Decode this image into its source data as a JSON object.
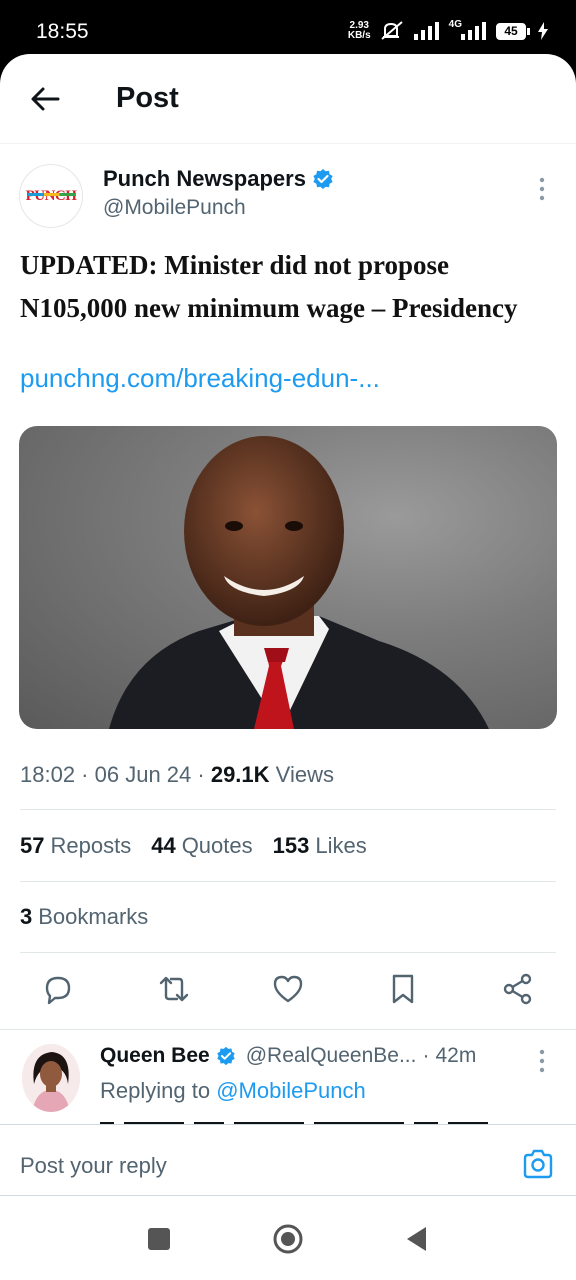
{
  "status_bar": {
    "time": "18:55",
    "speed_value": "2.93",
    "speed_unit": "KB/s",
    "network": "4G",
    "battery": "45"
  },
  "header": {
    "title": "Post",
    "back_icon": "arrow-left-icon"
  },
  "post": {
    "author_name": "Punch Newspapers",
    "author_handle": "@MobilePunch",
    "avatar_text": "PUNCH",
    "verified": true,
    "text": "UPDATED: Minister did not propose N105,000 new minimum wage – Presidency",
    "link": "punchng.com/breaking-edun-...",
    "time": "18:02",
    "date": "06 Jun 24",
    "views_count": "29.1K",
    "views_label": "Views",
    "reposts_count": "57",
    "reposts_label": "Reposts",
    "quotes_count": "44",
    "quotes_label": "Quotes",
    "likes_count": "153",
    "likes_label": "Likes",
    "bookmarks_count": "3",
    "bookmarks_label": "Bookmarks"
  },
  "reply": {
    "author_name": "Queen Bee",
    "author_handle": "@RealQueenBe...",
    "time": "42m",
    "replying_prefix": "Replying to",
    "replying_to": "@MobilePunch"
  },
  "composer": {
    "placeholder": "Post your reply"
  },
  "colors": {
    "accent": "#1d9bf0",
    "muted_text": "#536471",
    "verified_badge": "#1d9bf0"
  }
}
